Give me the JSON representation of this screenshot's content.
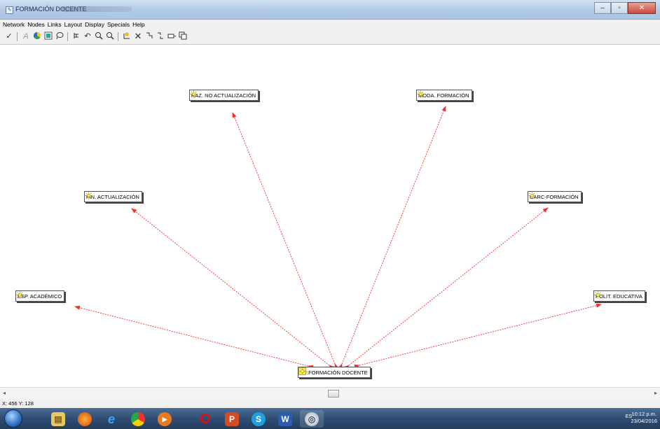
{
  "window": {
    "title": "FORMACIÓN DOCENTE",
    "minimize": "–",
    "maximize": "▫",
    "close": "✕"
  },
  "menu": [
    "Network",
    "Nodes",
    "Links",
    "Layout",
    "Display",
    "Specials",
    "Help"
  ],
  "toolbar": {
    "icons": [
      "check-icon",
      "text-icon",
      "color-wheel-icon",
      "color-box-icon",
      "lasso-icon",
      "tree-layout-icon",
      "undo-icon",
      "zoom-in-icon",
      "zoom-out-icon",
      "new-node-icon",
      "delete-icon",
      "link-icon",
      "unlink-icon",
      "label-icon",
      "copy-icon"
    ]
  },
  "network": {
    "center": "CF:FORMACIÓN DOCENTE",
    "nodes": [
      "RAZ. NO ACTUALIZACIÓN",
      "MODA. FORMACIÓN",
      "FIN. ACTUALIZACIÓN",
      "CARC-FORMACIÓN",
      "ESP. ACADÉMICO",
      "POLIT. EDUCATIVA"
    ],
    "link_color": "#ff2a2a"
  },
  "statusbar": {
    "coords": "X: 456 Y: 128"
  },
  "taskbar": {
    "apps": [
      "file-explorer-icon",
      "firefox-icon",
      "internet-explorer-icon",
      "chrome-icon",
      "media-player-icon",
      "opera-icon",
      "powerpoint-icon",
      "skype-icon",
      "word-icon",
      "network-app-icon"
    ],
    "lang": "ES",
    "time": "10:12 p.m.",
    "date": "23/04/2016"
  }
}
